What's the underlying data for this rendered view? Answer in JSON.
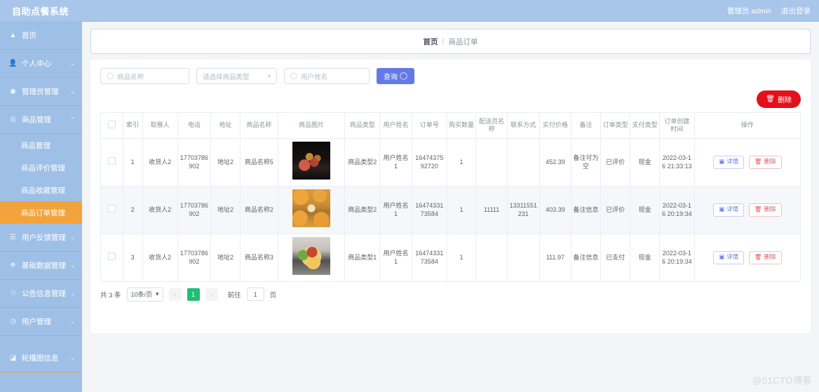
{
  "app": {
    "title": "自助点餐系统",
    "user_label": "管理员 admin",
    "logout_label": "退出登录"
  },
  "sidebar": {
    "items": [
      {
        "label": "首页",
        "icon": "home-icon",
        "caret": "",
        "active": false
      },
      {
        "label": "个人中心",
        "icon": "user-icon",
        "caret": "⌄",
        "active": false
      },
      {
        "label": "管理员管理",
        "icon": "admin-icon",
        "caret": "⌄",
        "active": false
      },
      {
        "label": "商品管理",
        "icon": "goods-icon",
        "caret": "⌃",
        "active": false
      }
    ],
    "submenu": [
      {
        "label": "商品管理",
        "active": false
      },
      {
        "label": "商品评价管理",
        "active": false
      },
      {
        "label": "商品收藏管理",
        "active": false
      },
      {
        "label": "商品订单管理",
        "active": true
      }
    ],
    "items_after": [
      {
        "label": "用户反馈管理",
        "icon": "feedback-icon",
        "caret": "⌄"
      },
      {
        "label": "基础数据管理",
        "icon": "data-icon",
        "caret": "⌄"
      },
      {
        "label": "公告信息管理",
        "icon": "notice-icon",
        "caret": "⌄"
      },
      {
        "label": "用户管理",
        "icon": "clock-icon",
        "caret": "⌄"
      },
      {
        "label": "轮播图信息",
        "icon": "carousel-icon",
        "caret": "⌄"
      }
    ]
  },
  "breadcrumb": {
    "home": "首页",
    "separator": "/",
    "current": "商品订单"
  },
  "filters": {
    "goods_name_placeholder": "商品名称",
    "goods_type_placeholder": "请选择商品类型",
    "user_name_placeholder": "用户姓名",
    "search_label": "查询",
    "search_icon": "search-icon",
    "chevron_icon": "chevron-down-icon"
  },
  "toolbar": {
    "delete_label": "删除",
    "delete_icon": "trash-icon",
    "delete_color": "#e3111b"
  },
  "table": {
    "headers": [
      "",
      "索引",
      "取餐人",
      "电话",
      "地址",
      "商品名称",
      "商品图片",
      "商品类型",
      "用户姓名",
      "订单号",
      "购买数量",
      "配送员名称",
      "联系方式",
      "实付价格",
      "备注",
      "订单类型",
      "支付类型",
      "订单创建时间",
      "操作"
    ],
    "rows": [
      {
        "index": "1",
        "receiver": "收货人2",
        "phone": "17703786902",
        "address": "地址2",
        "goods_name": "商品名称5",
        "image": "meat",
        "goods_type": "商品类型2",
        "user_name": "用户姓名1",
        "order_no": "1647437592720",
        "quantity": "1",
        "courier_name": "",
        "contact": "",
        "price": "452.39",
        "remark": "备注可为空",
        "order_type": "已评价",
        "pay_type": "现金",
        "create_time": "2022-03-16 21:33:13"
      },
      {
        "index": "2",
        "receiver": "收货人2",
        "phone": "17703786902",
        "address": "地址2",
        "goods_name": "商品名称2",
        "image": "fried",
        "goods_type": "商品类型2",
        "user_name": "用户姓名1",
        "order_no": "1647433173584",
        "quantity": "1",
        "courier_name": "11111",
        "contact": "13311551231",
        "price": "403.39",
        "remark": "备注信息",
        "order_type": "已评价",
        "pay_type": "现金",
        "create_time": "2022-03-16 20:19:34"
      },
      {
        "index": "3",
        "receiver": "收货人2",
        "phone": "17703786902",
        "address": "地址2",
        "goods_name": "商品名称3",
        "image": "pasta",
        "goods_type": "商品类型1",
        "user_name": "用户姓名1",
        "order_no": "1647433173584",
        "quantity": "1",
        "courier_name": "",
        "contact": "",
        "price": "111.97",
        "remark": "备注信息",
        "order_type": "已支付",
        "pay_type": "现金",
        "create_time": "2022-03-16 20:19:34"
      }
    ],
    "row_actions": {
      "detail_label": "详情",
      "detail_icon": "document-icon",
      "delete_label": "删除",
      "delete_icon": "trash-icon"
    }
  },
  "pager": {
    "total_label": "共 3 条",
    "page_size": "10条/页",
    "prev_icon": "chevron-left-icon",
    "next_icon": "chevron-right-icon",
    "current_page": "1",
    "jump_label": "前往",
    "jump_value": "1",
    "jump_unit": "页",
    "active_color": "#21bf73"
  },
  "watermark": "@51CTO博客"
}
